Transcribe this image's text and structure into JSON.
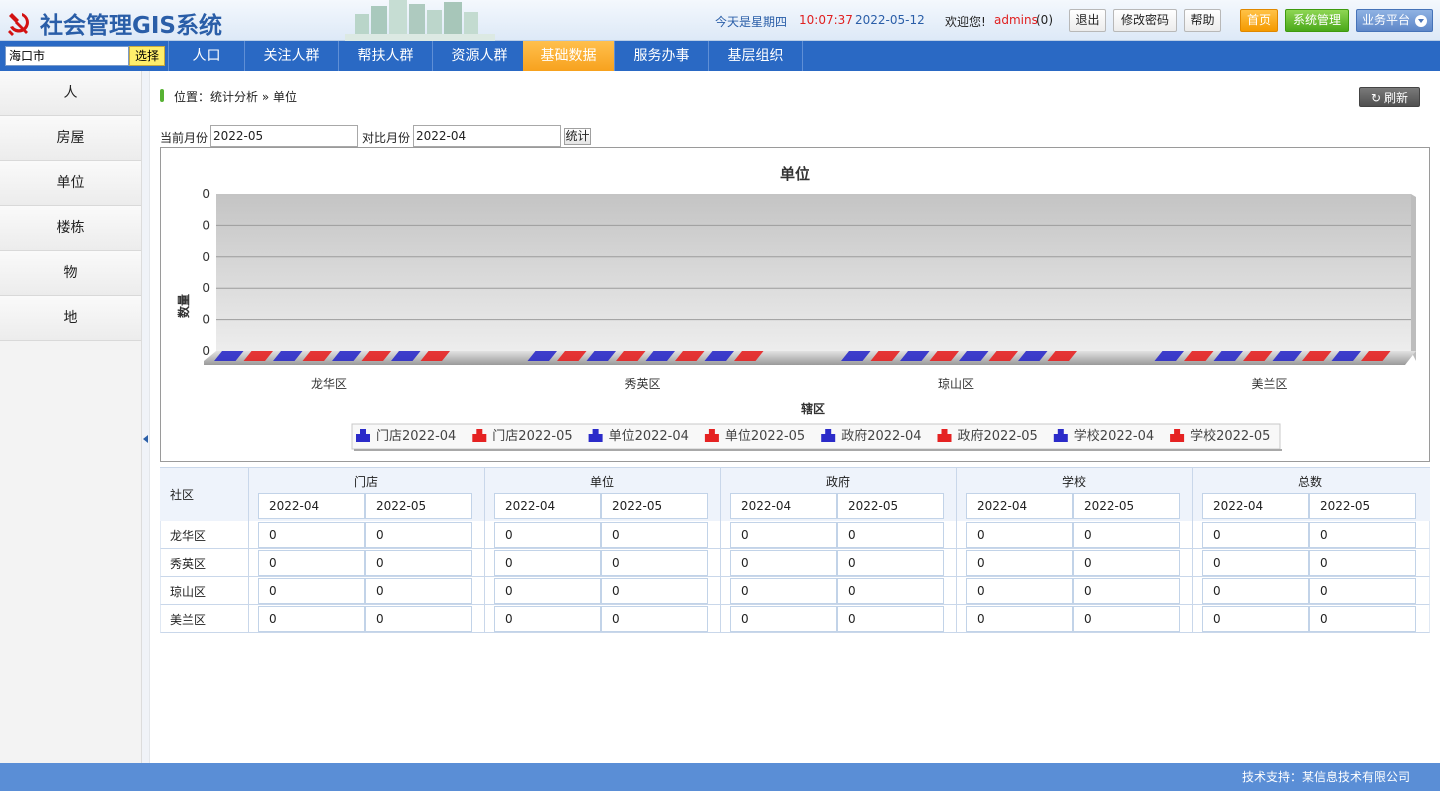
{
  "app": {
    "title": "社会管理GIS系统"
  },
  "header": {
    "today_label": "今天是星期四",
    "time": "10:07:37",
    "date": "2022-05-12",
    "welcome": "欢迎您!",
    "user": "admins",
    "msg_count": "(0)",
    "logout": "退出",
    "change_password": "修改密码",
    "help": "帮助",
    "home": "首页",
    "system_admin": "系统管理",
    "platform": "业务平台"
  },
  "nav": {
    "city": "海口市",
    "select": "选择",
    "items": [
      "人口",
      "关注人群",
      "帮扶人群",
      "资源人群",
      "基础数据",
      "服务办事",
      "基层组织"
    ],
    "active_index": 4
  },
  "sidebar": {
    "items": [
      "人",
      "房屋",
      "单位",
      "楼栋",
      "物",
      "地"
    ]
  },
  "breadcrumb": "位置：统计分析 » 单位",
  "refresh": "刷新",
  "filters": {
    "current_label": "当前月份",
    "current_value": "2022-05",
    "compare_label": "对比月份",
    "compare_value": "2022-04",
    "stat_button": "统计"
  },
  "chart_data": {
    "type": "bar",
    "title": "单位",
    "xlabel": "辖区",
    "ylabel": "数量",
    "categories": [
      "龙华区",
      "秀英区",
      "琼山区",
      "美兰区"
    ],
    "yticks": [
      "0",
      "0",
      "0",
      "0",
      "0",
      "0"
    ],
    "series": [
      {
        "name": "门店2022-04",
        "color": "#2b2bc9",
        "values": [
          0,
          0,
          0,
          0
        ]
      },
      {
        "name": "门店2022-05",
        "color": "#e52222",
        "values": [
          0,
          0,
          0,
          0
        ]
      },
      {
        "name": "单位2022-04",
        "color": "#2b2bc9",
        "values": [
          0,
          0,
          0,
          0
        ]
      },
      {
        "name": "单位2022-05",
        "color": "#e52222",
        "values": [
          0,
          0,
          0,
          0
        ]
      },
      {
        "name": "政府2022-04",
        "color": "#2b2bc9",
        "values": [
          0,
          0,
          0,
          0
        ]
      },
      {
        "name": "政府2022-05",
        "color": "#e52222",
        "values": [
          0,
          0,
          0,
          0
        ]
      },
      {
        "name": "学校2022-04",
        "color": "#2b2bc9",
        "values": [
          0,
          0,
          0,
          0
        ]
      },
      {
        "name": "学校2022-05",
        "color": "#e52222",
        "values": [
          0,
          0,
          0,
          0
        ]
      }
    ],
    "legend": "bottom-center",
    "grid": true
  },
  "table": {
    "row_header": "社区",
    "groups": [
      "门店",
      "单位",
      "政府",
      "学校",
      "总数"
    ],
    "months": [
      "2022-04",
      "2022-05"
    ],
    "rows": [
      {
        "name": "龙华区",
        "values": [
          "0",
          "0",
          "0",
          "0",
          "0",
          "0",
          "0",
          "0",
          "0",
          "0"
        ]
      },
      {
        "name": "秀英区",
        "values": [
          "0",
          "0",
          "0",
          "0",
          "0",
          "0",
          "0",
          "0",
          "0",
          "0"
        ]
      },
      {
        "name": "琼山区",
        "values": [
          "0",
          "0",
          "0",
          "0",
          "0",
          "0",
          "0",
          "0",
          "0",
          "0"
        ]
      },
      {
        "name": "美兰区",
        "values": [
          "0",
          "0",
          "0",
          "0",
          "0",
          "0",
          "0",
          "0",
          "0",
          "0"
        ]
      }
    ]
  },
  "footer": "技术支持：某信息技术有限公司"
}
